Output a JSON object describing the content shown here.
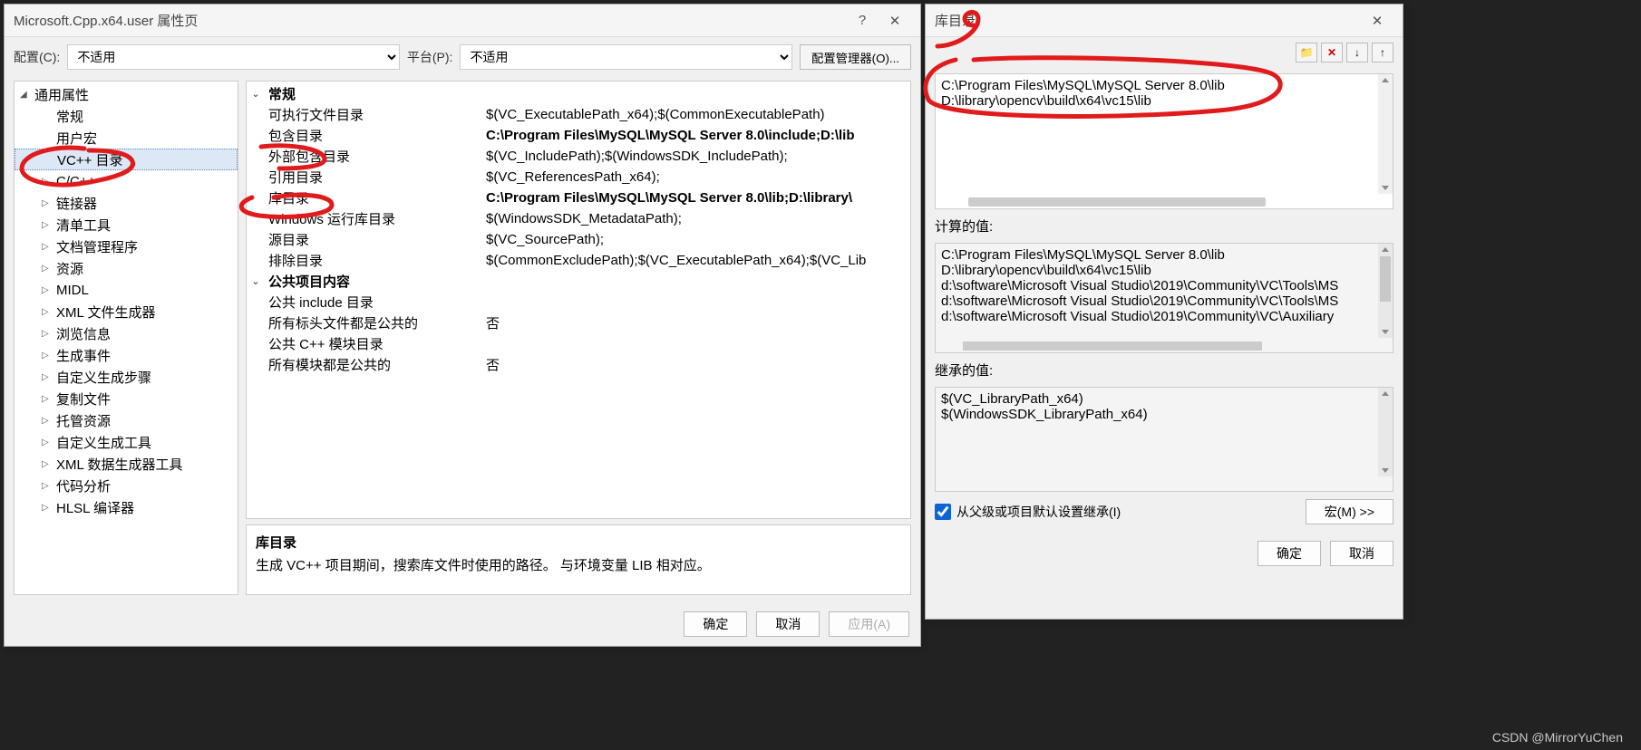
{
  "main_dialog": {
    "title": "Microsoft.Cpp.x64.user 属性页",
    "help_icon": "?",
    "close_icon": "✕",
    "config_label": "配置(C):",
    "config_value": "不适用",
    "platform_label": "平台(P):",
    "platform_value": "不适用",
    "config_mgr_btn": "配置管理器(O)...",
    "tree": [
      {
        "label": "通用属性",
        "arrow": "◢",
        "lvl": 0
      },
      {
        "label": "常规",
        "lvl": 1
      },
      {
        "label": "用户宏",
        "lvl": 1
      },
      {
        "label": "VC++ 目录",
        "lvl": 1,
        "selected": true
      },
      {
        "label": "C/C++",
        "lvl": 2,
        "arrow": "▷"
      },
      {
        "label": "链接器",
        "lvl": 2,
        "arrow": "▷"
      },
      {
        "label": "清单工具",
        "lvl": 2,
        "arrow": "▷"
      },
      {
        "label": "文档管理程序",
        "lvl": 2,
        "arrow": "▷"
      },
      {
        "label": "资源",
        "lvl": 2,
        "arrow": "▷"
      },
      {
        "label": "MIDL",
        "lvl": 2,
        "arrow": "▷"
      },
      {
        "label": "XML 文件生成器",
        "lvl": 2,
        "arrow": "▷"
      },
      {
        "label": "浏览信息",
        "lvl": 2,
        "arrow": "▷"
      },
      {
        "label": "生成事件",
        "lvl": 2,
        "arrow": "▷"
      },
      {
        "label": "自定义生成步骤",
        "lvl": 2,
        "arrow": "▷"
      },
      {
        "label": "复制文件",
        "lvl": 2,
        "arrow": "▷"
      },
      {
        "label": "托管资源",
        "lvl": 2,
        "arrow": "▷"
      },
      {
        "label": "自定义生成工具",
        "lvl": 2,
        "arrow": "▷"
      },
      {
        "label": "XML 数据生成器工具",
        "lvl": 2,
        "arrow": "▷"
      },
      {
        "label": "代码分析",
        "lvl": 2,
        "arrow": "▷"
      },
      {
        "label": "HLSL 编译器",
        "lvl": 2,
        "arrow": "▷"
      }
    ],
    "grid": [
      {
        "group": true,
        "arrow": "⌄",
        "name": "常规"
      },
      {
        "name": "可执行文件目录",
        "value": "$(VC_ExecutablePath_x64);$(CommonExecutablePath)"
      },
      {
        "name": "包含目录",
        "value": "C:\\Program Files\\MySQL\\MySQL Server 8.0\\include;D:\\lib",
        "bold": true
      },
      {
        "name": "外部包含目录",
        "value": "$(VC_IncludePath);$(WindowsSDK_IncludePath);"
      },
      {
        "name": "引用目录",
        "value": "$(VC_ReferencesPath_x64);"
      },
      {
        "name": "库目录",
        "value": "C:\\Program Files\\MySQL\\MySQL Server 8.0\\lib;D:\\library\\",
        "bold": true
      },
      {
        "name": "Windows 运行库目录",
        "value": "$(WindowsSDK_MetadataPath);"
      },
      {
        "name": "源目录",
        "value": "$(VC_SourcePath);"
      },
      {
        "name": "排除目录",
        "value": "$(CommonExcludePath);$(VC_ExecutablePath_x64);$(VC_Lib"
      },
      {
        "group": true,
        "arrow": "⌄",
        "name": "公共项目内容"
      },
      {
        "name": "公共 include 目录",
        "value": ""
      },
      {
        "name": "所有标头文件都是公共的",
        "value": "否"
      },
      {
        "name": "公共 C++ 模块目录",
        "value": ""
      },
      {
        "name": "所有模块都是公共的",
        "value": "否"
      }
    ],
    "desc": {
      "title": "库目录",
      "text": "生成 VC++ 项目期间，搜索库文件时使用的路径。  与环境变量 LIB 相对应。"
    },
    "buttons": {
      "ok": "确定",
      "cancel": "取消",
      "apply": "应用(A)"
    }
  },
  "edit_dialog": {
    "title": "库目录",
    "close_icon": "✕",
    "toolbar": {
      "new": "📁",
      "del": "✕",
      "down": "↓",
      "up": "↑"
    },
    "edit_lines": [
      "C:\\Program Files\\MySQL\\MySQL Server 8.0\\lib",
      "D:\\library\\opencv\\build\\x64\\vc15\\lib"
    ],
    "calc_label": "计算的值:",
    "calc_lines": [
      "C:\\Program Files\\MySQL\\MySQL Server 8.0\\lib",
      "D:\\library\\opencv\\build\\x64\\vc15\\lib",
      "d:\\software\\Microsoft Visual Studio\\2019\\Community\\VC\\Tools\\MS",
      "d:\\software\\Microsoft Visual Studio\\2019\\Community\\VC\\Tools\\MS",
      "d:\\software\\Microsoft Visual Studio\\2019\\Community\\VC\\Auxiliary"
    ],
    "inherit_label": "继承的值:",
    "inherit_lines": [
      "$(VC_LibraryPath_x64)",
      "$(WindowsSDK_LibraryPath_x64)"
    ],
    "inherit_check": "从父级或项目默认设置继承(I)",
    "macro_btn": "宏(M) >>",
    "buttons": {
      "ok": "确定",
      "cancel": "取消"
    }
  },
  "watermark": "CSDN @MirrorYuChen"
}
